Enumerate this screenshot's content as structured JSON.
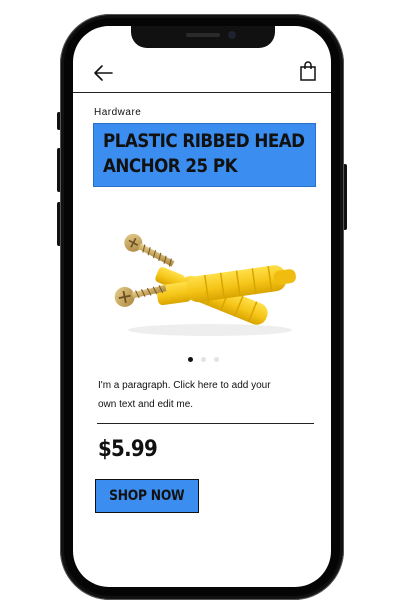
{
  "header": {
    "back_icon": "arrow-left-icon",
    "cart_icon": "shopping-bag-icon"
  },
  "product": {
    "category": "Hardware",
    "title_line1": "PLASTIC RIBBED HEAD",
    "title_line2": "ANCHOR 25 PK",
    "image": "yellow-plastic-anchors-with-brass-screws",
    "gallery": {
      "count": 3,
      "active_index": 0
    },
    "description_line1": "I'm a paragraph. Click here to add your",
    "description_line2": "own text and edit me.",
    "price": "$5.99",
    "cta_label": "SHOP NOW"
  },
  "colors": {
    "accent": "#3b8ef0",
    "text": "#111111",
    "phone_frame": "#111111",
    "plastic_yellow": "#f5c518",
    "brass": "#c9a45a"
  }
}
